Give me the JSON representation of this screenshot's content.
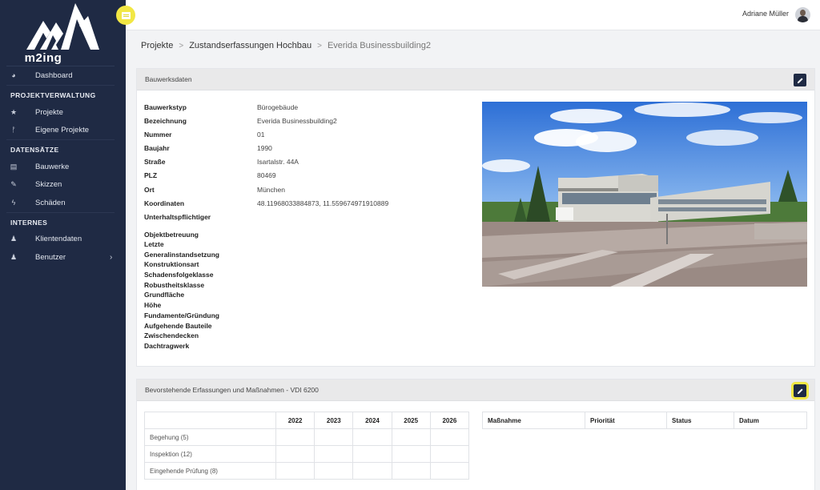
{
  "app": {
    "logo_text": "m2ing"
  },
  "sidebar": {
    "dashboard": "Dashboard",
    "sections": {
      "projekt": "PROJEKTVERWALTUNG",
      "daten": "DATENSÄTZE",
      "intern": "INTERNES"
    },
    "items": {
      "projekte": "Projekte",
      "eigene": "Eigene Projekte",
      "bauwerke": "Bauwerke",
      "skizzen": "Skizzen",
      "schaeden": "Schäden",
      "klienten": "Klientendaten",
      "benutzer": "Benutzer"
    }
  },
  "header": {
    "user_name": "Adriane Müller"
  },
  "breadcrumb": {
    "level1": "Projekte",
    "level2": "Zustandserfassungen Hochbau",
    "level3": "Everida Businessbuilding2"
  },
  "bauwerksdaten": {
    "title": "Bauwerksdaten",
    "labels": {
      "typ": "Bauwerkstyp",
      "bezeichnung": "Bezeichnung",
      "nummer": "Nummer",
      "baujahr": "Baujahr",
      "strasse": "Straße",
      "plz": "PLZ",
      "ort": "Ort",
      "koordinaten": "Koordinaten",
      "unterhalt": "Unterhaltspflichtiger",
      "objektbetreuung": "Objektbetreuung",
      "letzte": "Letzte",
      "generalinst": "Generalinstandsetzung",
      "konstruktionsart": "Konstruktionsart",
      "schadensfolge": "Schadensfolgeklasse",
      "robustheit": "Robustheitsklasse",
      "grundflaeche": "Grundfläche",
      "hoehe": "Höhe",
      "fundamente": "Fundamente/Gründung",
      "aufgehende": "Aufgehende Bauteile",
      "zwischendecken": "Zwischendecken",
      "dachtragwerk": "Dachtragwerk"
    },
    "values": {
      "typ": "Bürogebäude",
      "bezeichnung": "Everida Businessbuilding2",
      "nummer": "01",
      "baujahr": "1990",
      "strasse": "Isartalstr. 44A",
      "plz": "80469",
      "ort": "München",
      "koordinaten": "48.11968033884873, 11.559674971910889"
    }
  },
  "vdi": {
    "title": "Bevorstehende Erfassungen und Maßnahmen - VDI 6200",
    "years": [
      "2022",
      "2023",
      "2024",
      "2025",
      "2026"
    ],
    "rows": [
      "Begehung (5)",
      "Inspektion (12)",
      "Eingehende Prüfung (8)"
    ],
    "action_headers": {
      "massnahme": "Maßnahme",
      "prioritaet": "Priorität",
      "status": "Status",
      "datum": "Datum"
    }
  },
  "colors": {
    "sidebar_bg": "#1f2a44",
    "accent_yellow": "#f2e744",
    "edit_button": "#1f2a44"
  }
}
